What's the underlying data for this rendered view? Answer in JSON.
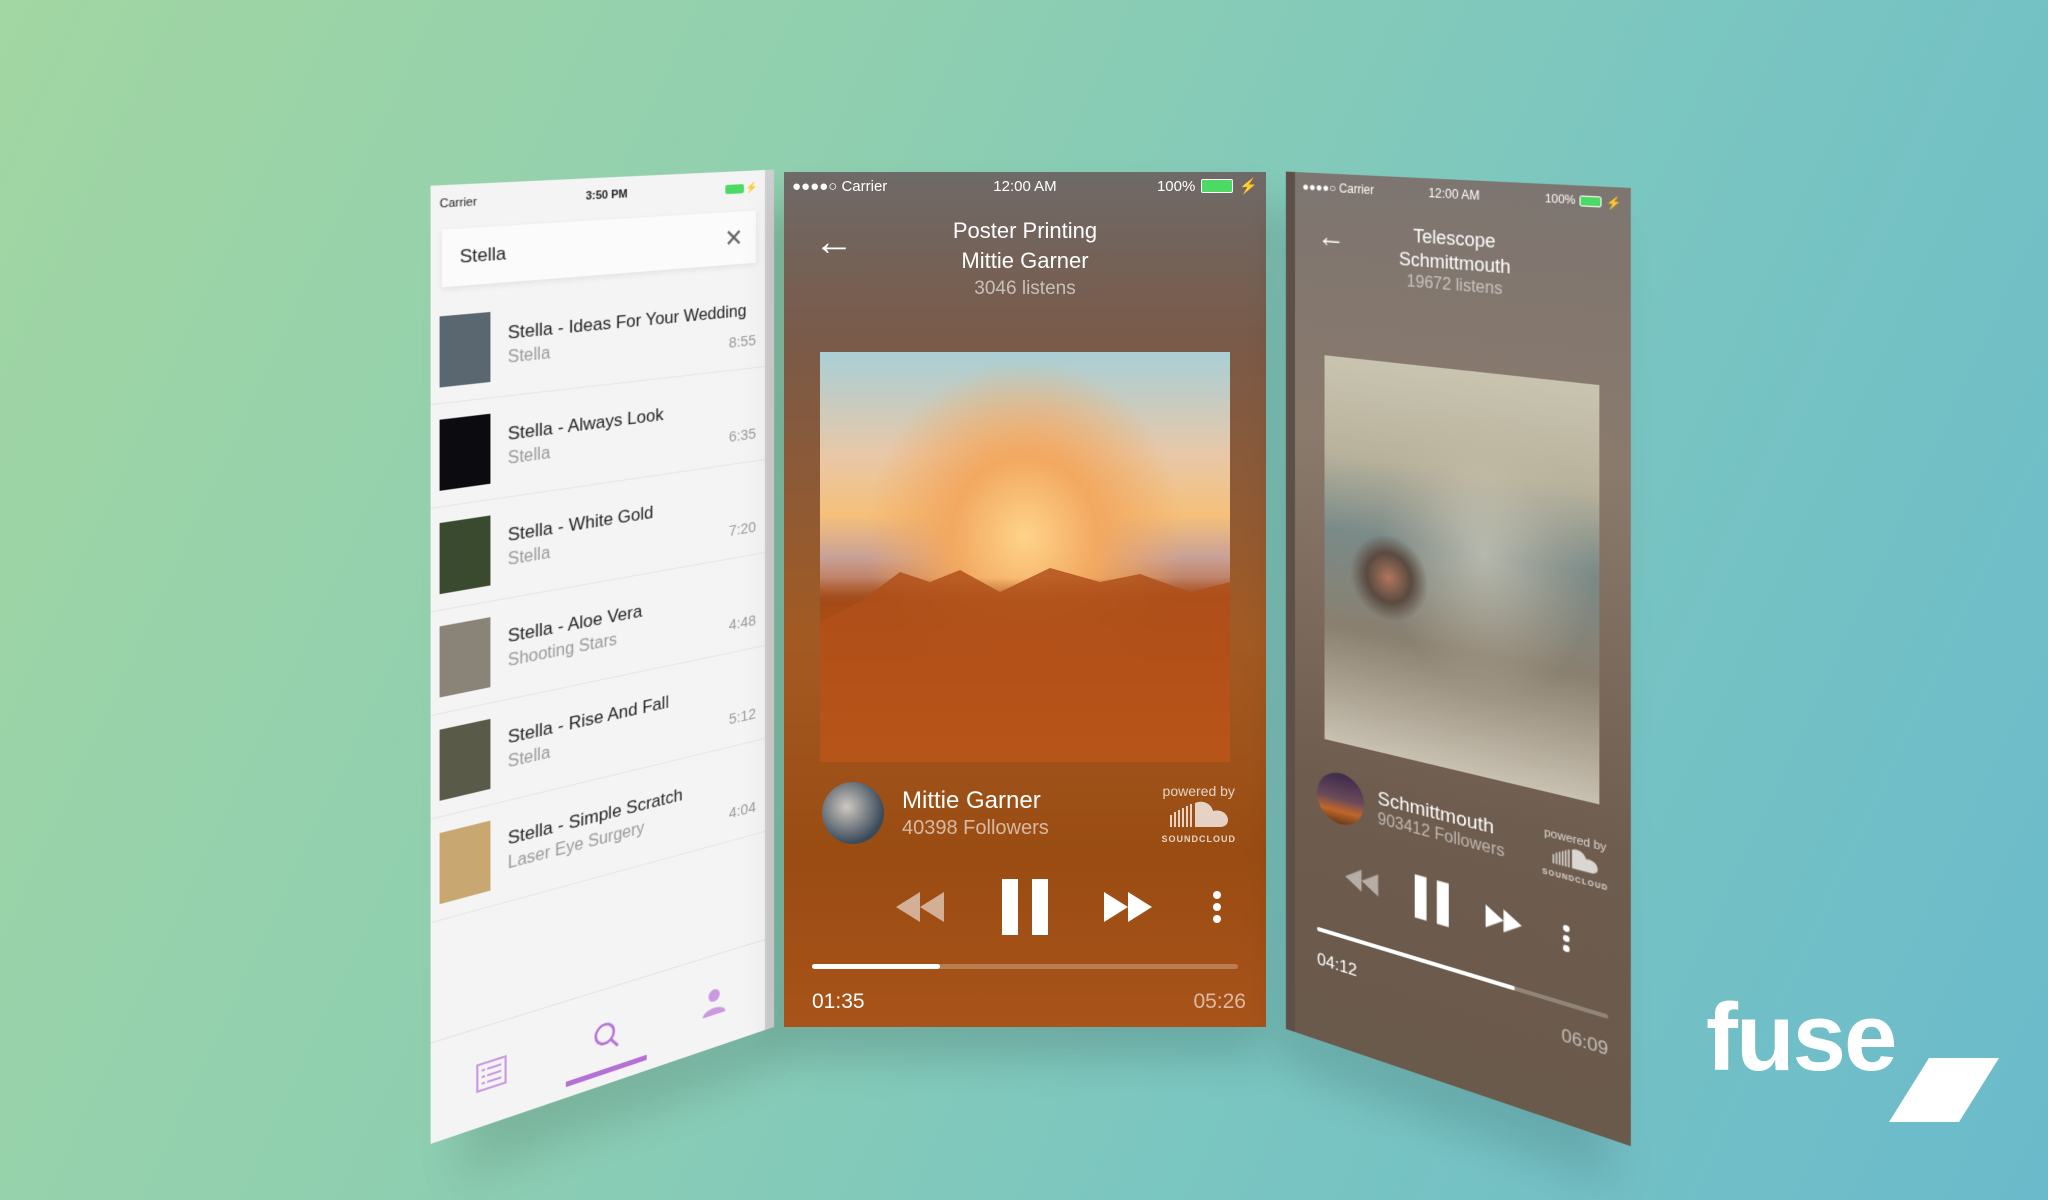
{
  "brand": {
    "logo_text": "fuse",
    "background_colors": [
      "#a2d6a2",
      "#6abacb"
    ],
    "accent": "#b570d8"
  },
  "left_phone": {
    "status": {
      "carrier": "Carrier",
      "time": "3:50 PM"
    },
    "search": {
      "value": "Stella",
      "clear_icon": "close-icon"
    },
    "results": [
      {
        "title": "Stella - Ideas For Your Wedding",
        "artist": "Stella",
        "duration": "8:55",
        "thumb_color": "#5a6670"
      },
      {
        "title": "Stella - Always Look",
        "artist": "Stella",
        "duration": "6:35",
        "thumb_color": "#0c0c10"
      },
      {
        "title": "Stella - White Gold",
        "artist": "Stella",
        "duration": "7:20",
        "thumb_color": "#3a4a2e"
      },
      {
        "title": "Stella - Aloe Vera",
        "artist": "Shooting Stars",
        "duration": "4:48",
        "thumb_color": "#8a8478"
      },
      {
        "title": "Stella - Rise And Fall",
        "artist": "Stella",
        "duration": "5:12",
        "thumb_color": "#5a5a48"
      },
      {
        "title": "Stella - Simple Scratch",
        "artist": "Laser Eye Surgery",
        "duration": "4:04",
        "thumb_color": "#c8a870"
      }
    ],
    "tabs": [
      {
        "name": "list",
        "icon": "list-icon",
        "active": false
      },
      {
        "name": "search",
        "icon": "search-icon",
        "active": true
      },
      {
        "name": "profile",
        "icon": "user-icon",
        "active": false
      }
    ]
  },
  "center_phone": {
    "status": {
      "carrier": "●●●●○ Carrier",
      "time": "12:00 AM",
      "battery": "100%"
    },
    "track": {
      "title": "Poster Printing",
      "artist": "Mittie Garner",
      "listens": "3046 listens"
    },
    "artist": {
      "name": "Mittie Garner",
      "followers": "40398 Followers"
    },
    "powered_by": "powered by",
    "soundcloud": "SOUNDCLOUD",
    "playback": {
      "elapsed": "01:35",
      "total": "05:26",
      "progress": 0.3
    }
  },
  "right_phone": {
    "status": {
      "carrier": "●●●●○ Carrier",
      "time": "12:00 AM",
      "battery": "100%"
    },
    "track": {
      "title": "Telescope",
      "artist": "Schmittmouth",
      "listens": "19672 listens"
    },
    "artist": {
      "name": "Schmittmouth",
      "followers": "903412 Followers"
    },
    "powered_by": "powered by",
    "soundcloud": "SOUNDCLOUD",
    "playback": {
      "elapsed": "04:12",
      "total": "06:09",
      "progress": 0.7
    }
  }
}
